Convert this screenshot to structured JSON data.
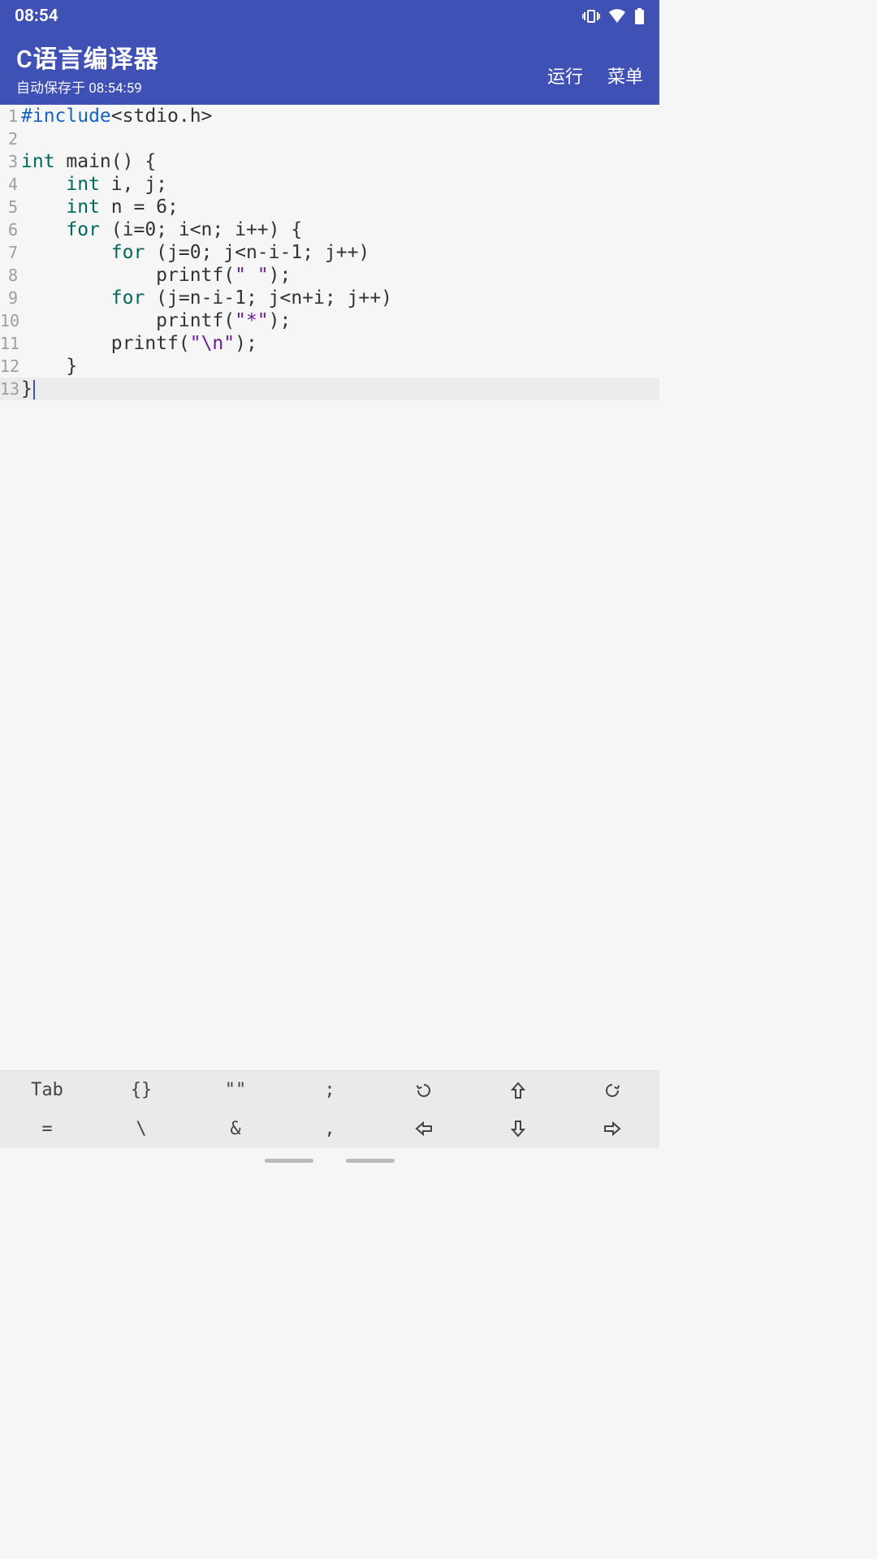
{
  "status": {
    "time": "08:54"
  },
  "header": {
    "title": "C语言编译器",
    "autosave": "自动保存于 08:54:59",
    "run_label": "运行",
    "menu_label": "菜单"
  },
  "editor": {
    "cursor_line": 13,
    "lines": [
      {
        "n": "1",
        "tokens": [
          [
            "pre",
            "#include"
          ],
          [
            "txt",
            "<stdio.h>"
          ]
        ]
      },
      {
        "n": "2",
        "tokens": []
      },
      {
        "n": "3",
        "tokens": [
          [
            "kw",
            "int"
          ],
          [
            "txt",
            " main() {"
          ]
        ]
      },
      {
        "n": "4",
        "tokens": [
          [
            "txt",
            "    "
          ],
          [
            "kw",
            "int"
          ],
          [
            "txt",
            " i, j;"
          ]
        ]
      },
      {
        "n": "5",
        "tokens": [
          [
            "txt",
            "    "
          ],
          [
            "kw",
            "int"
          ],
          [
            "txt",
            " n = 6;"
          ]
        ]
      },
      {
        "n": "6",
        "tokens": [
          [
            "txt",
            "    "
          ],
          [
            "kw",
            "for"
          ],
          [
            "txt",
            " (i=0; i<n; i++) {"
          ]
        ]
      },
      {
        "n": "7",
        "tokens": [
          [
            "txt",
            "        "
          ],
          [
            "kw",
            "for"
          ],
          [
            "txt",
            " (j=0; j<n-i-1; j++)"
          ]
        ]
      },
      {
        "n": "8",
        "tokens": [
          [
            "txt",
            "            printf("
          ],
          [
            "str",
            "\" \""
          ],
          [
            "txt",
            ");"
          ]
        ]
      },
      {
        "n": "9",
        "tokens": [
          [
            "txt",
            "        "
          ],
          [
            "kw",
            "for"
          ],
          [
            "txt",
            " (j=n-i-1; j<n+i; j++)"
          ]
        ]
      },
      {
        "n": "10",
        "tokens": [
          [
            "txt",
            "            printf("
          ],
          [
            "str",
            "\"*\""
          ],
          [
            "txt",
            ");"
          ]
        ]
      },
      {
        "n": "11",
        "tokens": [
          [
            "txt",
            "        printf("
          ],
          [
            "str",
            "\"\\n\""
          ],
          [
            "txt",
            ");"
          ]
        ]
      },
      {
        "n": "12",
        "tokens": [
          [
            "txt",
            "    }"
          ]
        ]
      },
      {
        "n": "13",
        "tokens": [
          [
            "txt",
            "}"
          ]
        ]
      }
    ]
  },
  "toolbar1": {
    "b0": "Tab",
    "b1": "{}",
    "b2": "\"\"",
    "b3": ";",
    "b4_icon": "undo",
    "b5_icon": "up",
    "b6_icon": "redo"
  },
  "toolbar2": {
    "b0": "=",
    "b1": "\\",
    "b2": "&",
    "b3": ",",
    "b4_icon": "left",
    "b5_icon": "down",
    "b6_icon": "right"
  }
}
